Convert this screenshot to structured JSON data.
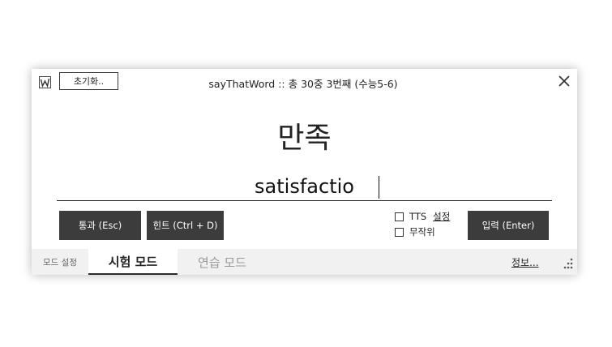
{
  "window": {
    "title": "sayThatWord :: 총 30중 3번째 (수능5-6)",
    "reset_label": "초기화.."
  },
  "question": {
    "word": "만족"
  },
  "answer": {
    "value": "satisfactio",
    "placeholder": ""
  },
  "buttons": {
    "pass_label": "통과 (Esc)",
    "hint_label": "힌트 (Ctrl + D)",
    "enter_label": "입력 (Enter)"
  },
  "options": {
    "tts_label": "TTS",
    "tts_checked": false,
    "tts_settings_label": "설정",
    "shuffle_label": "무작위",
    "shuffle_checked": false
  },
  "footer": {
    "mode_label": "모드 설정",
    "tabs": [
      {
        "label": "시험 모드",
        "active": true
      },
      {
        "label": "연습 모드",
        "active": false
      }
    ],
    "info_label": "정보..."
  },
  "colors": {
    "button_bg": "#3c3c3c",
    "footer_bg": "#f1f1f1",
    "inactive_tab_text": "#9a9a9a"
  }
}
